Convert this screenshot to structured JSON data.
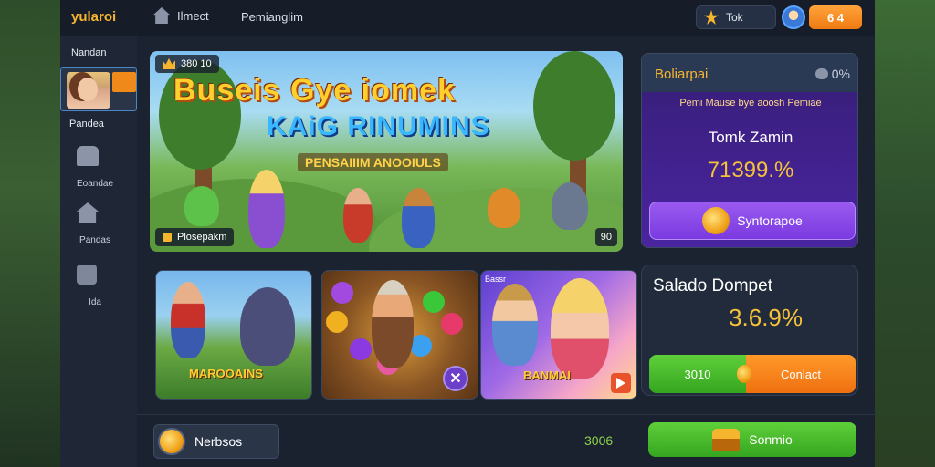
{
  "header": {
    "logo": "yularoi",
    "nav_home": "Ilmect",
    "nav_second": "Pemianglim",
    "tk_label": "Tok",
    "coin_value": "6 4"
  },
  "sidebar": {
    "heading": "Nandan",
    "profile_label": "Pandea",
    "items": [
      {
        "label": "Eoandae",
        "icon": "chest-icon"
      },
      {
        "label": "Pandas",
        "icon": "home-icon"
      },
      {
        "label": "Ida",
        "icon": "tool-icon"
      }
    ]
  },
  "banner": {
    "chip_text": "380 10",
    "title_line1": "Buseis Gye iomek",
    "title_line2": "KAiG RINUMINS",
    "subtitle": "PENSAIIIM ANOOIULS",
    "footer_label": "Plosepakm",
    "count": "90"
  },
  "cards": [
    {
      "title": "MAROOAINS"
    },
    {
      "title": ""
    },
    {
      "title": "BANMAI",
      "chip": "Bassr"
    }
  ],
  "promo": {
    "title": "Boliarpai",
    "percent": "0%",
    "description": "Pemi Mause bye aoosh Pemiae",
    "label": "Tomk Zamin",
    "value": "71399.%",
    "button_label": "Syntorapoe"
  },
  "balance": {
    "title": "Salado Dompet",
    "value": "3.6.9%",
    "left_button": "3010",
    "right_button": "Conlact"
  },
  "bottom": {
    "left_label": "Nerbsos",
    "amount": "3006",
    "button_label": "Sonmio"
  },
  "colors": {
    "accent": "#f6b52e",
    "green": "#35a620",
    "orange": "#ef7b12",
    "purple": "#4a25a0"
  }
}
